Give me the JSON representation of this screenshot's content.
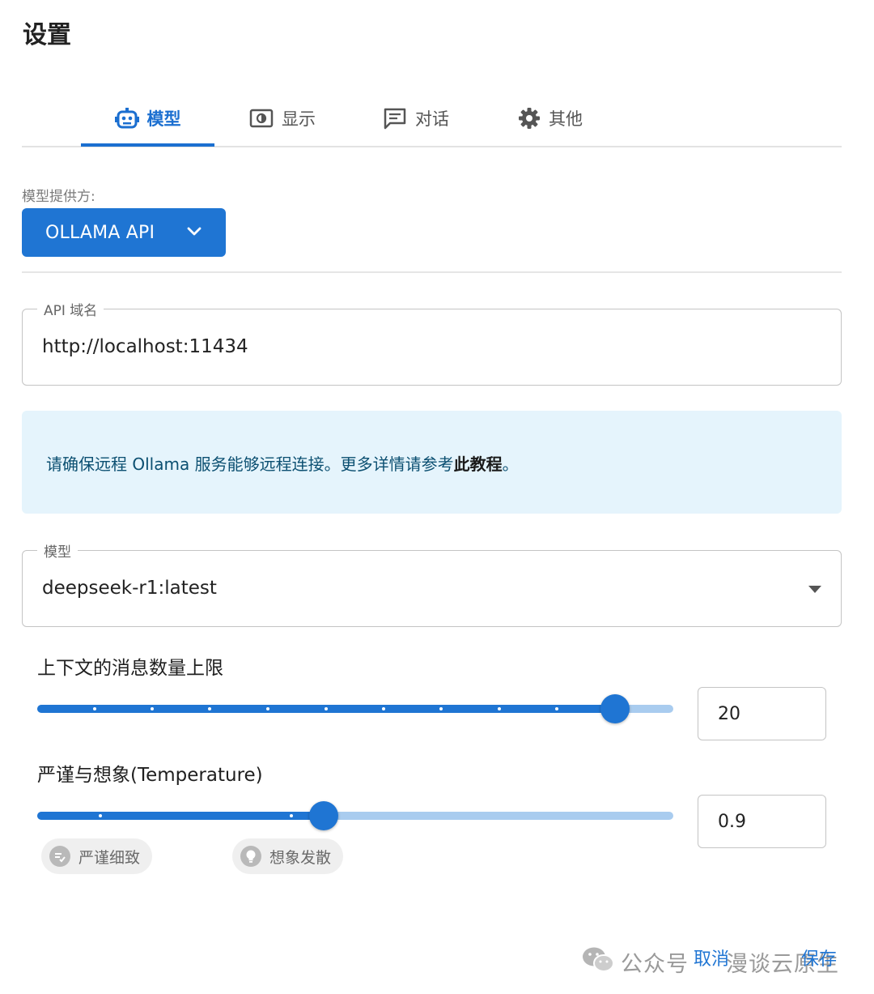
{
  "page_title": "设置",
  "tabs": [
    {
      "label": "模型",
      "icon": "robot-icon",
      "active": true
    },
    {
      "label": "显示",
      "icon": "display-icon",
      "active": false
    },
    {
      "label": "对话",
      "icon": "chat-icon",
      "active": false
    },
    {
      "label": "其他",
      "icon": "gear-icon",
      "active": false
    }
  ],
  "provider": {
    "label": "模型提供方:",
    "value": "OLLAMA API"
  },
  "api_domain": {
    "label": "API 域名",
    "value": "http://localhost:11434"
  },
  "info": {
    "text": "请确保远程 Ollama 服务能够远程连接。更多详情请参考",
    "link": "此教程",
    "suffix": "。"
  },
  "model": {
    "label": "模型",
    "value": "deepseek-r1:latest"
  },
  "context_limit": {
    "label": "上下文的消息数量上限",
    "value": "20",
    "fraction": 0.909
  },
  "temperature": {
    "label": "严谨与想象(Temperature)",
    "value": "0.9",
    "fraction": 0.45,
    "chips": [
      "严谨细致",
      "想象发散"
    ]
  },
  "footer": {
    "watermark": "公众号",
    "watermark_rest": "漫谈云原生",
    "cancel": "取消",
    "save": "保存"
  },
  "colors": {
    "primary": "#1f75d3",
    "info_bg": "#e5f4fc",
    "info_text": "#0b4f71"
  }
}
